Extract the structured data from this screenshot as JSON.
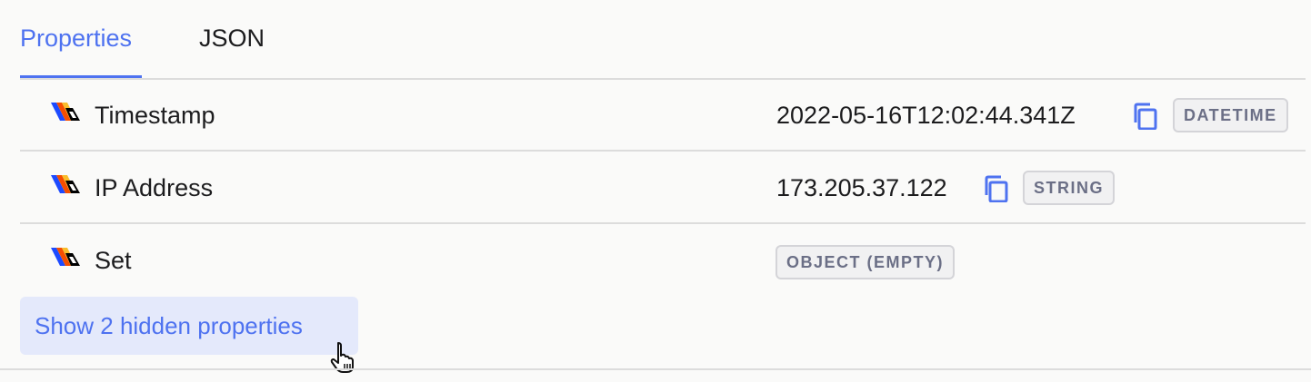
{
  "tabs": {
    "properties": "Properties",
    "json": "JSON"
  },
  "properties": [
    {
      "name": "Timestamp",
      "value": "2022-05-16T12:02:44.341Z",
      "type": "DATETIME",
      "icon": "posthog-property-icon",
      "copy_icon": "copy-icon"
    },
    {
      "name": "IP Address",
      "value": "173.205.37.122",
      "type": "STRING",
      "icon": "posthog-property-icon",
      "copy_icon": "copy-icon"
    },
    {
      "name": "Set",
      "value": "",
      "type": "OBJECT (EMPTY)",
      "icon": "posthog-property-icon"
    }
  ],
  "show_hidden_label": "Show 2 hidden properties",
  "colors": {
    "accent": "#4e72f0",
    "badge_text": "#6b6f86",
    "button_bg": "#e4e9fb"
  }
}
